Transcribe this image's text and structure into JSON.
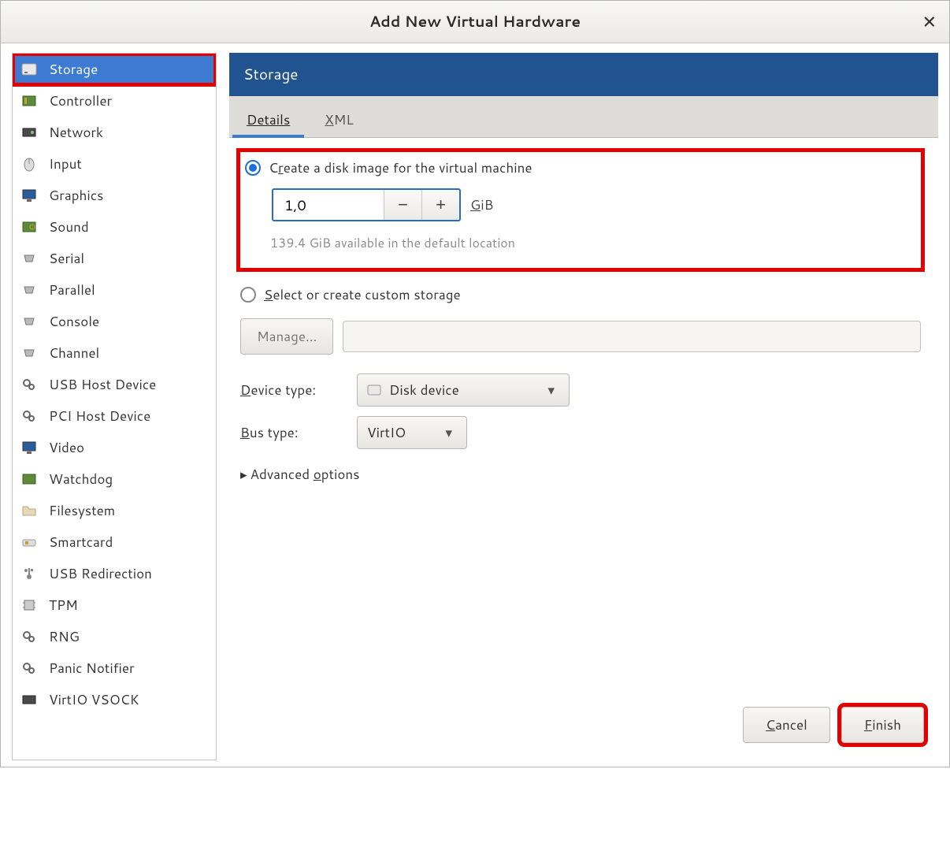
{
  "window": {
    "title": "Add New Virtual Hardware"
  },
  "sidebar": {
    "items": [
      {
        "label": "Storage",
        "icon": "disk-icon",
        "active": true,
        "highlight": true
      },
      {
        "label": "Controller",
        "icon": "card-icon"
      },
      {
        "label": "Network",
        "icon": "nic-icon"
      },
      {
        "label": "Input",
        "icon": "mouse-icon"
      },
      {
        "label": "Graphics",
        "icon": "display-icon"
      },
      {
        "label": "Sound",
        "icon": "sound-icon"
      },
      {
        "label": "Serial",
        "icon": "port-icon"
      },
      {
        "label": "Parallel",
        "icon": "port-icon"
      },
      {
        "label": "Console",
        "icon": "port-icon"
      },
      {
        "label": "Channel",
        "icon": "port-icon"
      },
      {
        "label": "USB Host Device",
        "icon": "gears-icon"
      },
      {
        "label": "PCI Host Device",
        "icon": "gears-icon"
      },
      {
        "label": "Video",
        "icon": "display-icon"
      },
      {
        "label": "Watchdog",
        "icon": "card-icon"
      },
      {
        "label": "Filesystem",
        "icon": "folder-icon"
      },
      {
        "label": "Smartcard",
        "icon": "smartcard-icon"
      },
      {
        "label": "USB Redirection",
        "icon": "usb-icon"
      },
      {
        "label": "TPM",
        "icon": "chip-icon"
      },
      {
        "label": "RNG",
        "icon": "gears-icon"
      },
      {
        "label": "Panic Notifier",
        "icon": "gears-icon"
      },
      {
        "label": "VirtIO VSOCK",
        "icon": "nic-icon"
      }
    ]
  },
  "main": {
    "header": "Storage",
    "tabs": {
      "details": "Details",
      "xml": "XML",
      "active": "details"
    },
    "create_disk": {
      "label": "Create a disk image for the virtual machine",
      "size_value": "1,0",
      "unit": "GiB",
      "available_hint": "139.4 GiB available in the default location",
      "highlight": true
    },
    "custom_storage": {
      "label": "Select or create custom storage",
      "manage_label": "Manage...",
      "path_value": ""
    },
    "device_type": {
      "label": "Device type:",
      "value": "Disk device"
    },
    "bus_type": {
      "label": "Bus type:",
      "value": "VirtIO"
    },
    "advanced_label": "Advanced options"
  },
  "footer": {
    "cancel": "Cancel",
    "finish": "Finish",
    "finish_highlight": true
  }
}
